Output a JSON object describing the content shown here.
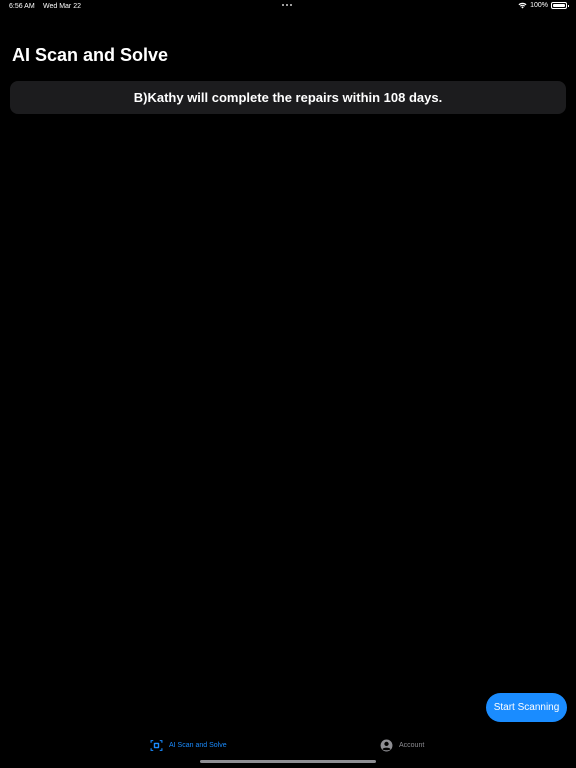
{
  "status_bar": {
    "time": "6:56 AM",
    "date": "Wed Mar 22",
    "battery": "100%",
    "battery_level": 1.0
  },
  "header": {
    "title": "AI Scan and Solve"
  },
  "answer": {
    "text": "B)Kathy will complete the repairs within 108 days."
  },
  "actions": {
    "start_scanning_label": "Start Scanning"
  },
  "tab_bar": {
    "tabs": [
      {
        "label": "AI Scan and Solve",
        "icon": "scan-icon",
        "active": true
      },
      {
        "label": "Account",
        "icon": "person-circle-icon",
        "active": false
      }
    ]
  },
  "colors": {
    "accent": "#1a8cff",
    "background": "#000000",
    "card": "#1c1c1e",
    "inactive": "#8e8e93"
  }
}
